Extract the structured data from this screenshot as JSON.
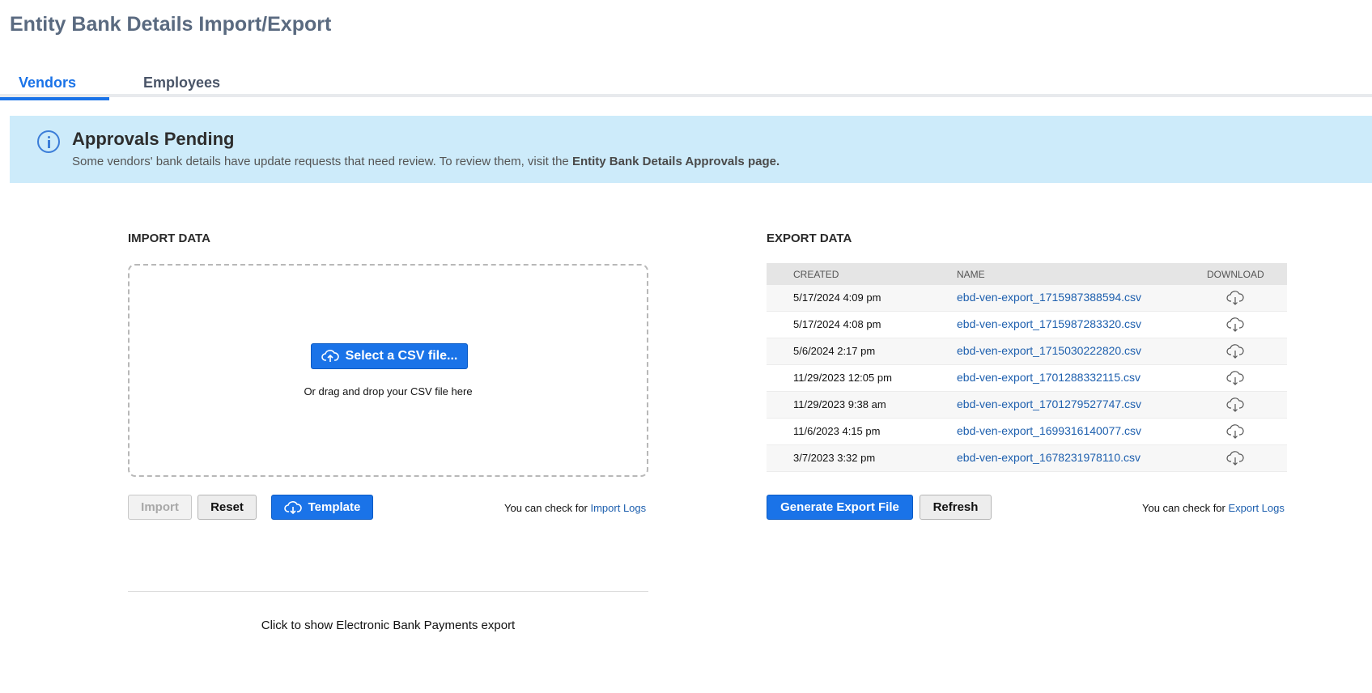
{
  "page": {
    "title": "Entity Bank Details Import/Export"
  },
  "tabs": [
    {
      "label": "Vendors",
      "active": true
    },
    {
      "label": "Employees",
      "active": false
    }
  ],
  "banner": {
    "title": "Approvals Pending",
    "text": "Some vendors' bank details have update requests that need review. To review them, visit the ",
    "link_text": "Entity Bank Details Approvals page.",
    "icon": "info-icon"
  },
  "import": {
    "label": "IMPORT DATA",
    "select_button": "Select a CSV file...",
    "drop_hint": "Or drag and drop your CSV file here",
    "import_button": "Import",
    "reset_button": "Reset",
    "template_button": "Template",
    "check_text": "You can check for ",
    "logs_link": "Import Logs"
  },
  "export": {
    "label": "EXPORT DATA",
    "columns": {
      "created": "CREATED",
      "name": "NAME",
      "download": "DOWNLOAD"
    },
    "rows": [
      {
        "created": "5/17/2024 4:09 pm",
        "name": "ebd-ven-export_1715987388594.csv"
      },
      {
        "created": "5/17/2024 4:08 pm",
        "name": "ebd-ven-export_1715987283320.csv"
      },
      {
        "created": "5/6/2024 2:17 pm",
        "name": "ebd-ven-export_1715030222820.csv"
      },
      {
        "created": "11/29/2023 12:05 pm",
        "name": "ebd-ven-export_1701288332115.csv"
      },
      {
        "created": "11/29/2023 9:38 am",
        "name": "ebd-ven-export_1701279527747.csv"
      },
      {
        "created": "11/6/2023 4:15 pm",
        "name": "ebd-ven-export_1699316140077.csv"
      },
      {
        "created": "3/7/2023 3:32 pm",
        "name": "ebd-ven-export_1678231978110.csv"
      }
    ],
    "generate_button": "Generate Export File",
    "refresh_button": "Refresh",
    "check_text": "You can check for ",
    "logs_link": "Export Logs"
  },
  "ebp": {
    "link_text": "Click to show Electronic Bank Payments export"
  },
  "colors": {
    "accent": "#1a73e8",
    "banner_bg": "#cdebfa",
    "link": "#1d5fae",
    "title": "#5a6a80"
  }
}
